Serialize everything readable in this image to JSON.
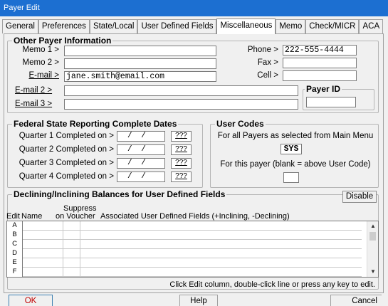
{
  "window": {
    "title": "Payer Edit"
  },
  "tabs": [
    "General",
    "Preferences",
    "State/Local",
    "User Defined Fields",
    "Miscellaneous",
    "Memo",
    "Check/MICR",
    "ACA"
  ],
  "other_info": {
    "title": "Other Payer Information",
    "memo1_label": "Memo 1 >",
    "memo2_label": "Memo 2 >",
    "email_label": "E-mail >",
    "email2_label": "E-mail 2 >",
    "email3_label": "E-mail 3 >",
    "phone_label": "Phone >",
    "fax_label": "Fax >",
    "cell_label": "Cell >",
    "memo1_value": "",
    "memo2_value": "",
    "email_value": "jane.smith@email.com",
    "email2_value": "",
    "email3_value": "",
    "phone_value": "222-555-4444",
    "fax_value": "",
    "cell_value": "",
    "payer_id_label": "Payer ID",
    "payer_id_value": ""
  },
  "federal": {
    "title": "Federal State Reporting Complete Dates",
    "quarters": [
      {
        "label": "Quarter 1 Completed on >",
        "value": "/ /",
        "btn": "???"
      },
      {
        "label": "Quarter 2 Completed on >",
        "value": "/ /",
        "btn": "???"
      },
      {
        "label": "Quarter 3 Completed on >",
        "value": "/ /",
        "btn": "???"
      },
      {
        "label": "Quarter 4 Completed on >",
        "value": "/ /",
        "btn": "???"
      }
    ]
  },
  "user_codes": {
    "title": "User Codes",
    "all_payers_text": "For all Payers as selected from Main Menu",
    "all_payers_value": "SYS",
    "this_payer_text": "For this payer (blank = above User Code)",
    "this_payer_value": ""
  },
  "balances": {
    "title": "Declining/Inclining Balances for User Defined Fields",
    "disable_label": "Disable",
    "col_edit": "Edit",
    "col_name": "Name",
    "col_suppress_1": "Suppress",
    "col_suppress_2": "on Voucher",
    "col_associated": "Associated User Defined Fields (+Inclining, -Declining)",
    "rows": [
      "A",
      "B",
      "C",
      "D",
      "E",
      "F"
    ],
    "hint": "Click Edit column,  double-click line or press any key to edit."
  },
  "footer": {
    "ok": "OK",
    "help": "Help",
    "cancel": "Cancel"
  }
}
